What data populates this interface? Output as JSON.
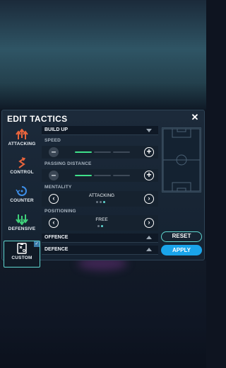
{
  "modal": {
    "title": "EDIT TACTICS",
    "close_icon": "close-icon"
  },
  "sidebar": {
    "items": [
      {
        "label": "ATTACKING",
        "icon": "attacking-arrows-icon",
        "color": "#e8643c"
      },
      {
        "label": "CONTROL",
        "icon": "control-zigzag-icon",
        "color": "#e8643c"
      },
      {
        "label": "COUNTER",
        "icon": "counter-swirl-icon",
        "color": "#3d8ee8"
      },
      {
        "label": "DEFENSIVE",
        "icon": "defensive-arrows-icon",
        "color": "#3fd07a"
      },
      {
        "label": "CUSTOM",
        "icon": "custom-board-icon",
        "color": "#ffffff",
        "selected": true
      }
    ]
  },
  "build_up": {
    "header": "BUILD UP",
    "speed": {
      "label": "SPEED",
      "level": 1,
      "max": 3
    },
    "passing_distance": {
      "label": "PASSING DISTANCE",
      "level": 1,
      "max": 3
    },
    "mentality": {
      "label": "MENTALITY",
      "value": "ATTACKING",
      "index": 3,
      "count": 3
    },
    "positioning": {
      "label": "POSITIONING",
      "value": "FREE",
      "index": 2,
      "count": 2
    }
  },
  "offence": {
    "header": "OFFENCE"
  },
  "defence": {
    "header": "DEFENCE"
  },
  "buttons": {
    "reset": "RESET",
    "apply": "APPLY"
  },
  "colors": {
    "accent": "#5fd6d0",
    "active_bar": "#3fe08a",
    "apply": "#1aa4ea"
  }
}
